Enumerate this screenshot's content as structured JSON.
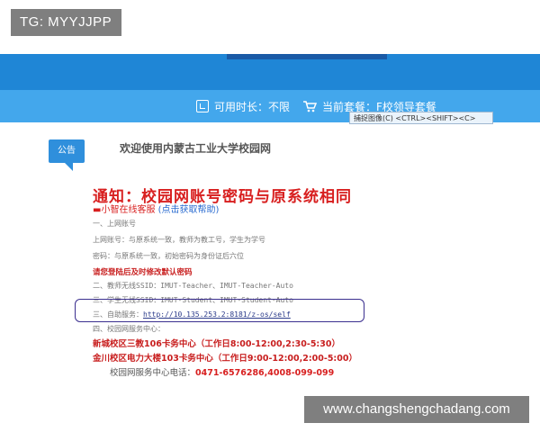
{
  "watermark_top": "TG: MYYJJPP",
  "header_bar": {
    "duration_label": "可用时长：不限",
    "package_label": "当前套餐：F校领导套餐"
  },
  "tooltip": "捕捉图像(C)  <CTRL><SHIFT><C>",
  "badge": "公告",
  "welcome": "欢迎使用内蒙古工业大学校园网",
  "notice_title": "通知：校园网账号密码与原系统相同",
  "sub_prefix": "▬小智在线客服",
  "sub_link": "(点击获取帮助)",
  "lines": [
    "一、上网账号",
    "上网账号：与原系统一致，教师为教工号，学生为学号",
    "密码：与原系统一致，初始密码为身份证后六位",
    "请您登陆后及时修改默认密码",
    "二、教师无线SSID：IMUT-Teacher、IMUT-Teacher-Auto",
    "三、学生无线SSID：IMUT-Student、IMUT-Student-Auto",
    "三、自助服务：",
    "四、校园网服务中心："
  ],
  "self_service_url": "http://10.135.253.2:8181/z-os/self",
  "service_centers": [
    "新城校区三教106卡务中心（工作日8:00-12:00,2:30-5:30）",
    "金川校区电力大楼103卡务中心（工作日9:00-12:00,2:00-5:00）"
  ],
  "phone_label": "校园网服务中心电话：",
  "phone_value": "0471-6576286,4008-099-099",
  "watermark_bottom": "www.changshengchadang.com"
}
